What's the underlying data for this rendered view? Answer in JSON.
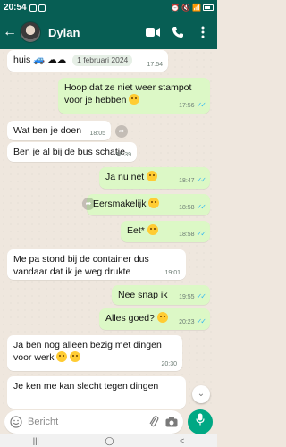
{
  "statusbar": {
    "time": "20:54"
  },
  "header": {
    "contact_name": "Dylan"
  },
  "messages": [
    {
      "dir": "in",
      "text_main": "huis",
      "date_chip": "1 februari 2024",
      "time": "17:54"
    },
    {
      "dir": "out",
      "text_main": "Hoop dat ze niet weer stampot voor je hebben",
      "time": "17:56"
    },
    {
      "dir": "in",
      "text_main": "Wat ben je doen",
      "time": "18:05"
    },
    {
      "dir": "in",
      "text_main": "Ben je al bij de bus schatje",
      "time": "18:39"
    },
    {
      "dir": "out",
      "text_main": "Ja nu net",
      "time": "18:47"
    },
    {
      "dir": "out",
      "text_main": "Eersmakelijk",
      "time": "18:58"
    },
    {
      "dir": "out",
      "text_main": "Eet*",
      "time": "18:58"
    },
    {
      "dir": "in",
      "text_main": "Me pa stond bij de container dus vandaar dat ik je weg drukte",
      "time": "19:01"
    },
    {
      "dir": "out",
      "text_main": "Nee snap ik",
      "time": "19:55"
    },
    {
      "dir": "out",
      "text_main": "Alles goed?",
      "time": "20:23"
    },
    {
      "dir": "in",
      "text_main": "Ja ben nog alleen bezig met dingen voor werk",
      "time": "20:30"
    },
    {
      "dir": "in",
      "text_main": "Je ken me kan slecht tegen dingen",
      "time": ""
    }
  ],
  "input": {
    "placeholder": "Bericht"
  },
  "icons": {
    "back": "arrow-left-icon",
    "video": "video-camera-icon",
    "call": "phone-icon",
    "menu": "kebab-menu-icon",
    "emoji": "emoji-icon",
    "attach": "paperclip-icon",
    "camera": "camera-icon",
    "mic": "microphone-icon"
  },
  "colors": {
    "header": "#075e54",
    "outgoing": "#dcf8c6",
    "incoming": "#ffffff",
    "accent": "#00a884",
    "ticks": "#34b7f1"
  }
}
